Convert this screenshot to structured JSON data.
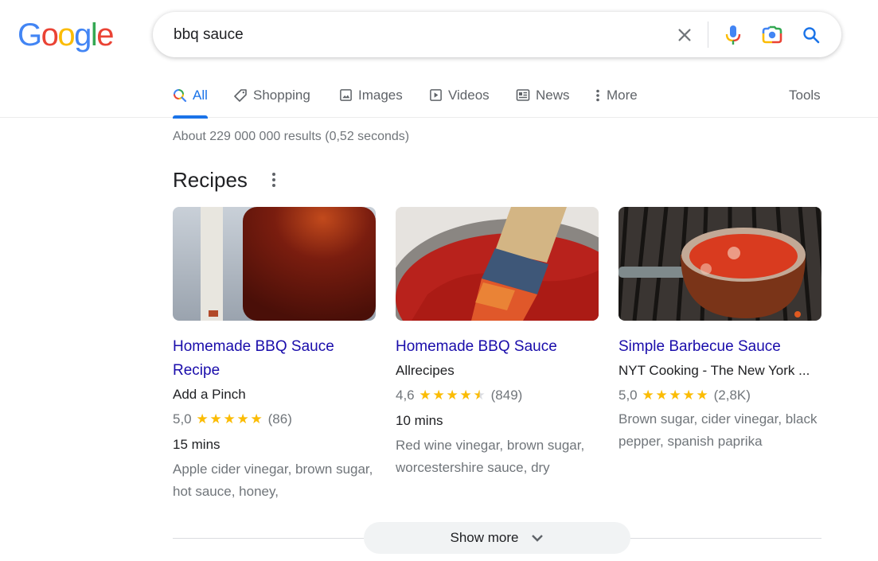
{
  "logo": {
    "letters": [
      "G",
      "o",
      "o",
      "g",
      "l",
      "e"
    ],
    "colors": [
      "#4285f4",
      "#ea4335",
      "#fbbc05",
      "#4285f4",
      "#34a853",
      "#ea4335"
    ]
  },
  "search": {
    "value": "bbq sauce",
    "clear_icon": "close-icon",
    "voice_icon": "microphone-icon",
    "lens_icon": "camera-lens-icon",
    "submit_icon": "search-icon"
  },
  "tabs": [
    {
      "label": "All",
      "icon": "search-icon",
      "active": true
    },
    {
      "label": "Shopping",
      "icon": "tag-icon"
    },
    {
      "label": "Images",
      "icon": "image-icon"
    },
    {
      "label": "Videos",
      "icon": "play-icon"
    },
    {
      "label": "News",
      "icon": "newspaper-icon"
    },
    {
      "label": "More",
      "icon": "more-vert-icon"
    }
  ],
  "tools_label": "Tools",
  "result_stats": "About 229 000 000 results (0,52 seconds)",
  "recipes": {
    "title": "Recipes",
    "cards": [
      {
        "title": "Homemade BBQ Sauce Recipe",
        "source": "Add a Pinch",
        "rating": "5,0",
        "rating_value": 5.0,
        "reviews": "(86)",
        "time": "15 mins",
        "ingredients": "Apple cider vinegar, brown sugar, hot sauce, honey,"
      },
      {
        "title": "Homemade BBQ Sauce",
        "source": "Allrecipes",
        "rating": "4,6",
        "rating_value": 4.6,
        "reviews": "(849)",
        "time": "10 mins",
        "ingredients": "Red wine vinegar, brown sugar, worcestershire sauce, dry"
      },
      {
        "title": "Simple Barbecue Sauce",
        "source": "NYT Cooking - The New York ...",
        "rating": "5,0",
        "rating_value": 5.0,
        "reviews": "(2,8K)",
        "time": "",
        "ingredients": "Brown sugar, cider vinegar, black pepper, spanish paprika"
      }
    ]
  },
  "show_more_label": "Show more",
  "colors": {
    "link": "#1a0dab",
    "accent": "#1a73e8",
    "star": "#fbbc04",
    "muted": "#70757a"
  }
}
